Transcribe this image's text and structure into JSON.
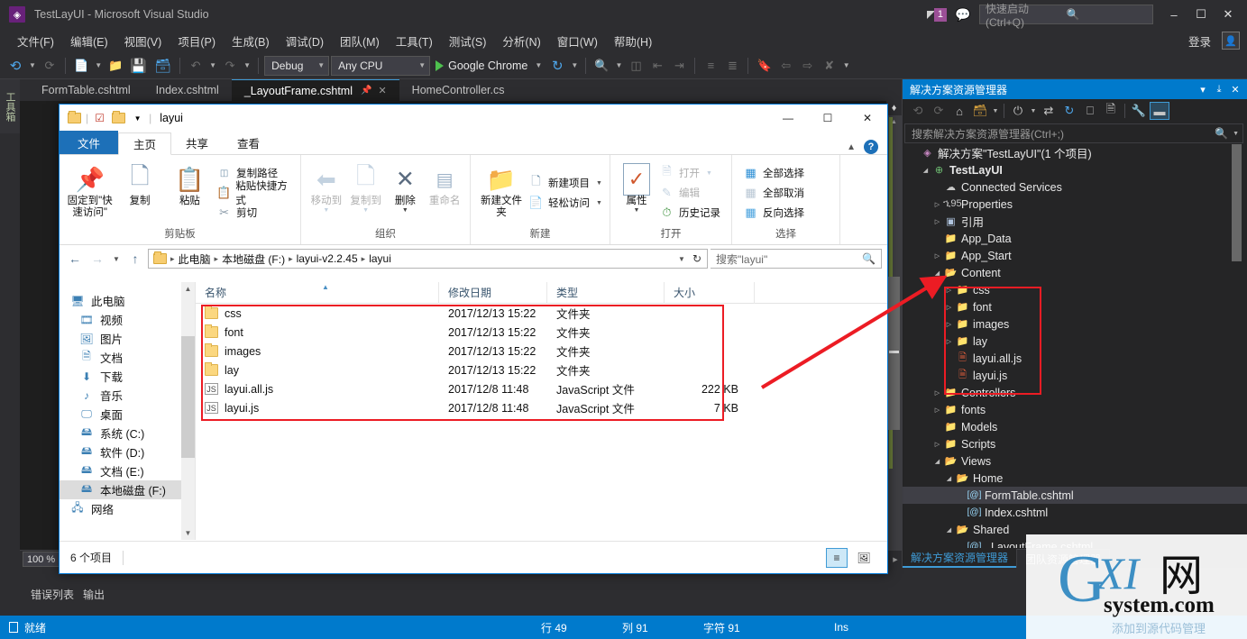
{
  "vs": {
    "title": "TestLayUI - Microsoft Visual Studio",
    "logo_glyph": "◈",
    "notification_count": "1",
    "quick_launch_placeholder": "快速启动 (Ctrl+Q)",
    "sign_in": "登录",
    "minimize": "–",
    "maximize": "☐",
    "close": "✕",
    "menu": [
      "文件(F)",
      "编辑(E)",
      "视图(V)",
      "项目(P)",
      "生成(B)",
      "调试(D)",
      "团队(M)",
      "工具(T)",
      "测试(S)",
      "分析(N)",
      "窗口(W)",
      "帮助(H)"
    ],
    "toolbar": {
      "config_value": "Debug",
      "platform_value": "Any CPU",
      "run_target": "Google Chrome"
    },
    "toolbox_label": "工具箱",
    "tabs": [
      {
        "label": "FormTable.cshtml",
        "active": false
      },
      {
        "label": "Index.cshtml",
        "active": false
      },
      {
        "label": "_LayoutFrame.cshtml",
        "active": true
      },
      {
        "label": "HomeController.cs",
        "active": false
      }
    ],
    "editor": {
      "zoom": "100 %",
      "bottom_tabs": [
        "错误列表",
        "输出"
      ]
    },
    "statusbar": {
      "ready": "就绪",
      "line": "行 49",
      "column": "列 91",
      "char": "字符 91",
      "ins": "Ins"
    }
  },
  "solution_explorer": {
    "title": "解决方案资源管理器",
    "header_buttons": [
      "▾",
      "⤓",
      "✕"
    ],
    "search_placeholder": "搜索解决方案资源管理器(Ctrl+;)",
    "tree": [
      {
        "label": "解决方案\"TestLayUI\"(1 个项目)",
        "indent": 0,
        "twisty": "",
        "icon": "vs",
        "bold": false,
        "selected": false
      },
      {
        "label": "TestLayUI",
        "indent": 1,
        "twisty": "open",
        "icon": "web",
        "bold": true,
        "selected": false
      },
      {
        "label": "Connected Services",
        "indent": 2,
        "twisty": "",
        "icon": "cloud",
        "bold": false,
        "selected": false
      },
      {
        "label": "Properties",
        "indent": 2,
        "twisty": "closed",
        "icon": "wrench",
        "bold": false,
        "selected": false
      },
      {
        "label": "引用",
        "indent": 2,
        "twisty": "closed",
        "icon": "ref",
        "bold": false,
        "selected": false
      },
      {
        "label": "App_Data",
        "indent": 2,
        "twisty": "",
        "icon": "folder",
        "bold": false,
        "selected": false
      },
      {
        "label": "App_Start",
        "indent": 2,
        "twisty": "closed",
        "icon": "folder",
        "bold": false,
        "selected": false
      },
      {
        "label": "Content",
        "indent": 2,
        "twisty": "open",
        "icon": "openfolder",
        "bold": false,
        "selected": false
      },
      {
        "label": "css",
        "indent": 3,
        "twisty": "closed",
        "icon": "folder",
        "bold": false,
        "selected": false
      },
      {
        "label": "font",
        "indent": 3,
        "twisty": "closed",
        "icon": "folder",
        "bold": false,
        "selected": false
      },
      {
        "label": "images",
        "indent": 3,
        "twisty": "closed",
        "icon": "folder",
        "bold": false,
        "selected": false
      },
      {
        "label": "lay",
        "indent": 3,
        "twisty": "closed",
        "icon": "folder",
        "bold": false,
        "selected": false
      },
      {
        "label": "layui.all.js",
        "indent": 3,
        "twisty": "",
        "icon": "js",
        "bold": false,
        "selected": false
      },
      {
        "label": "layui.js",
        "indent": 3,
        "twisty": "",
        "icon": "js",
        "bold": false,
        "selected": false
      },
      {
        "label": "Controllers",
        "indent": 2,
        "twisty": "closed",
        "icon": "folder",
        "bold": false,
        "selected": false
      },
      {
        "label": "fonts",
        "indent": 2,
        "twisty": "closed",
        "icon": "folder",
        "bold": false,
        "selected": false
      },
      {
        "label": "Models",
        "indent": 2,
        "twisty": "",
        "icon": "folder",
        "bold": false,
        "selected": false
      },
      {
        "label": "Scripts",
        "indent": 2,
        "twisty": "closed",
        "icon": "folder",
        "bold": false,
        "selected": false
      },
      {
        "label": "Views",
        "indent": 2,
        "twisty": "open",
        "icon": "openfolder",
        "bold": false,
        "selected": false
      },
      {
        "label": "Home",
        "indent": 3,
        "twisty": "open",
        "icon": "openfolder",
        "bold": false,
        "selected": false
      },
      {
        "label": "FormTable.cshtml",
        "indent": 4,
        "twisty": "",
        "icon": "razor",
        "bold": false,
        "selected": true
      },
      {
        "label": "Index.cshtml",
        "indent": 4,
        "twisty": "",
        "icon": "razor",
        "bold": false,
        "selected": false
      },
      {
        "label": "Shared",
        "indent": 3,
        "twisty": "open",
        "icon": "openfolder",
        "bold": false,
        "selected": false
      },
      {
        "label": "_LayoutFrame.cshtml",
        "indent": 4,
        "twisty": "",
        "icon": "razor",
        "bold": false,
        "selected": false
      }
    ],
    "footer_tabs": [
      {
        "label": "解决方案资源管理器",
        "active": true
      },
      {
        "label": "团队资源管理器",
        "active": false
      }
    ]
  },
  "file_explorer": {
    "title": "layui",
    "window_buttons": [
      "—",
      "☐",
      "✕"
    ],
    "ribbon_tabs": [
      {
        "label": "文件",
        "type": "file"
      },
      {
        "label": "主页",
        "type": "active"
      },
      {
        "label": "共享",
        "type": "normal"
      },
      {
        "label": "查看",
        "type": "normal"
      }
    ],
    "ribbon_groups": [
      {
        "name": "剪贴板",
        "big": [
          {
            "label": "固定到\"快速访问\"",
            "glyph": "📌",
            "disabled": false,
            "caret": false
          },
          {
            "label": "复制",
            "glyph": "❐",
            "disabled": false,
            "caret": false
          },
          {
            "label": "粘贴",
            "glyph": "📋",
            "disabled": false,
            "caret": false
          }
        ],
        "small": [
          {
            "label": "复制路径",
            "glyph": "⎘",
            "disabled": false,
            "caret": false
          },
          {
            "label": "粘贴快捷方式",
            "glyph": "❐",
            "disabled": false,
            "caret": false
          },
          {
            "label": "剪切",
            "glyph": "✂",
            "disabled": false,
            "caret": false
          }
        ]
      },
      {
        "name": "组织",
        "big": [
          {
            "label": "移动到",
            "glyph": "⬅",
            "disabled": true,
            "caret": true
          },
          {
            "label": "复制到",
            "glyph": "❐",
            "disabled": true,
            "caret": true
          },
          {
            "label": "删除",
            "glyph": "✕",
            "disabled": false,
            "caret": true
          },
          {
            "label": "重命名",
            "glyph": "⬒",
            "disabled": true,
            "caret": false
          }
        ],
        "small": []
      },
      {
        "name": "新建",
        "big": [
          {
            "label": "新建文件夹",
            "glyph": "📁",
            "disabled": false,
            "caret": false
          }
        ],
        "small": [
          {
            "label": "新建项目",
            "glyph": "❐",
            "disabled": false,
            "caret": true
          },
          {
            "label": "轻松访问",
            "glyph": "☰",
            "disabled": false,
            "caret": true
          }
        ]
      },
      {
        "name": "打开",
        "big": [
          {
            "label": "属性",
            "glyph": "✓",
            "disabled": false,
            "caret": true
          }
        ],
        "small": [
          {
            "label": "打开",
            "glyph": "☰",
            "disabled": true,
            "caret": true
          },
          {
            "label": "编辑",
            "glyph": "✎",
            "disabled": true,
            "caret": false
          },
          {
            "label": "历史记录",
            "glyph": "◴",
            "disabled": false,
            "caret": false
          }
        ]
      },
      {
        "name": "选择",
        "big": [],
        "small": [
          {
            "label": "全部选择",
            "glyph": "▦",
            "disabled": false,
            "caret": false
          },
          {
            "label": "全部取消",
            "glyph": "▦",
            "disabled": false,
            "caret": false
          },
          {
            "label": "反向选择",
            "glyph": "▦",
            "disabled": false,
            "caret": false
          }
        ]
      }
    ],
    "breadcrumbs": [
      "此电脑",
      "本地磁盘 (F:)",
      "layui-v2.2.45",
      "layui"
    ],
    "search_placeholder": "搜索\"layui\"",
    "nav_items": [
      {
        "label": "此电脑",
        "icon": "monitor",
        "root": true,
        "selected": false
      },
      {
        "label": "视频",
        "icon": "video",
        "root": false,
        "selected": false
      },
      {
        "label": "图片",
        "icon": "picture",
        "root": false,
        "selected": false
      },
      {
        "label": "文档",
        "icon": "doc",
        "root": false,
        "selected": false
      },
      {
        "label": "下载",
        "icon": "download",
        "root": false,
        "selected": false
      },
      {
        "label": "音乐",
        "icon": "music",
        "root": false,
        "selected": false
      },
      {
        "label": "桌面",
        "icon": "desktop",
        "root": false,
        "selected": false
      },
      {
        "label": "系统 (C:)",
        "icon": "drive-sys",
        "root": false,
        "selected": false
      },
      {
        "label": "软件 (D:)",
        "icon": "drive",
        "root": false,
        "selected": false
      },
      {
        "label": "文档 (E:)",
        "icon": "drive",
        "root": false,
        "selected": false
      },
      {
        "label": "本地磁盘 (F:)",
        "icon": "drive",
        "root": false,
        "selected": true
      },
      {
        "label": "网络",
        "icon": "network",
        "root": true,
        "selected": false
      }
    ],
    "columns": [
      "名称",
      "修改日期",
      "类型",
      "大小"
    ],
    "rows": [
      {
        "name": "css",
        "modified": "2017/12/13 15:22",
        "type": "文件夹",
        "size": "",
        "icon": "folder"
      },
      {
        "name": "font",
        "modified": "2017/12/13 15:22",
        "type": "文件夹",
        "size": "",
        "icon": "folder"
      },
      {
        "name": "images",
        "modified": "2017/12/13 15:22",
        "type": "文件夹",
        "size": "",
        "icon": "folder"
      },
      {
        "name": "lay",
        "modified": "2017/12/13 15:22",
        "type": "文件夹",
        "size": "",
        "icon": "folder"
      },
      {
        "name": "layui.all.js",
        "modified": "2017/12/8 11:48",
        "type": "JavaScript 文件",
        "size": "222 KB",
        "icon": "js"
      },
      {
        "name": "layui.js",
        "modified": "2017/12/8 11:48",
        "type": "JavaScript 文件",
        "size": "7 KB",
        "icon": "js"
      }
    ],
    "status_text": "6 个项目"
  },
  "watermark": {
    "main": "XI",
    "g": "G",
    "cn": "网",
    "sub": "system.com",
    "behind": "添加到源代码管理",
    "color": "#3d8fc4"
  },
  "colors": {
    "vs_accent": "#007acc",
    "annotation_red": "#ec1c24",
    "explorer_blue": "#1d70b8"
  }
}
